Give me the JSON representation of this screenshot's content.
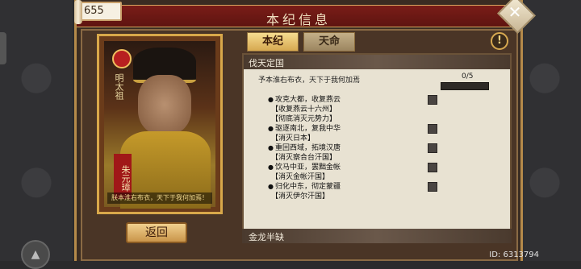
{
  "counter": "655",
  "title": "本纪信息",
  "tabs": [
    {
      "label": "本纪",
      "active": true
    },
    {
      "label": "天命",
      "active": false
    }
  ],
  "portrait": {
    "side_text": "明太祖",
    "name_text": "朱元璋",
    "quote": "朕本淮右布衣，天下于我何加焉！"
  },
  "back_button": "返回",
  "panel": {
    "header": "伐天定国",
    "slogan": "予本淮右布衣，天下于我何加焉",
    "progress_text": "0/5",
    "progress": 0,
    "tasks": [
      {
        "label": "攻克大都，收复燕云",
        "subs": [
          "【收复燕云十六州】",
          "【彻底消灭元势力】"
        ]
      },
      {
        "label": "驱逐南北，复我中华",
        "subs": [
          "【消灭日本】"
        ]
      },
      {
        "label": "重回西域，拓境汉唐",
        "subs": [
          "【消灭察合台汗国】"
        ]
      },
      {
        "label": "饮马中亚，罢黜金帐",
        "subs": [
          "【消灭金帐汗国】"
        ]
      },
      {
        "label": "归化中东，彻定蒙疆",
        "subs": [
          "【消灭伊尔汗国】"
        ]
      }
    ],
    "footer": "金龙半缺"
  },
  "id_text": "ID: 6313794"
}
